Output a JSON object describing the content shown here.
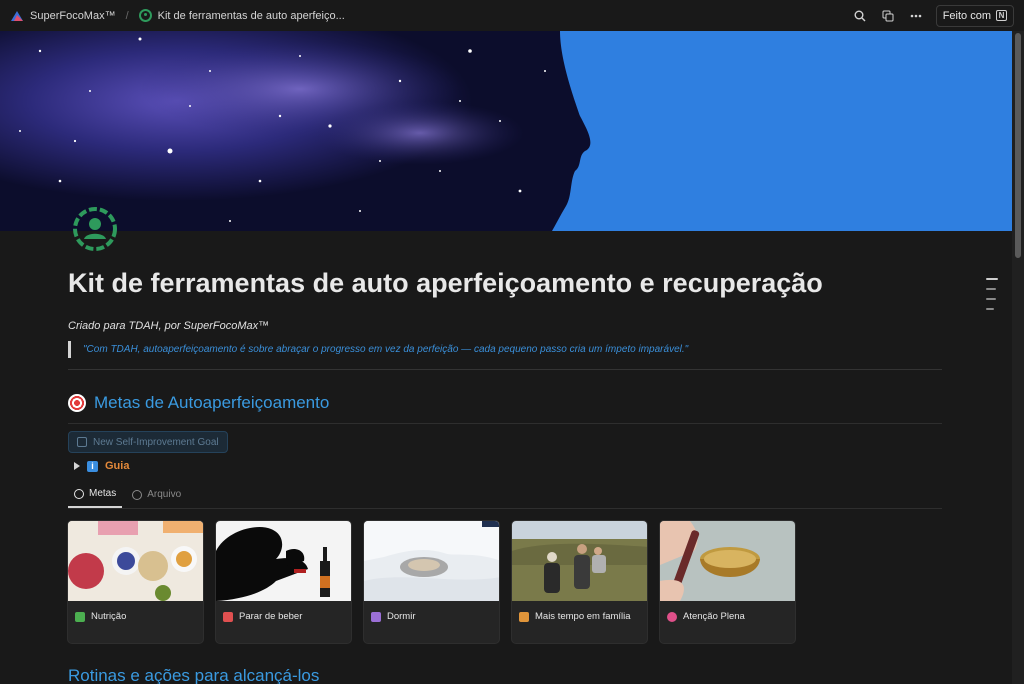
{
  "breadcrumb": {
    "workspace": "SuperFocoMax™",
    "page": "Kit de ferramentas de auto aperfeiço..."
  },
  "topbar": {
    "made_with": "Feito com"
  },
  "page": {
    "title": "Kit de ferramentas de auto aperfeiçoamento e recuperação",
    "subtitle": "Criado para TDAH, por SuperFocoMax™",
    "quote": "\"Com TDAH, autoaperfeiçoamento é sobre abraçar o progresso em vez da perfeição — cada pequeno passo cria um ímpeto imparável.\""
  },
  "goals": {
    "heading": "Metas de Autoaperfeiçoamento",
    "new_button": "New Self-Improvement Goal",
    "guide": "Guia",
    "tabs": [
      {
        "label": "Metas"
      },
      {
        "label": "Arquivo"
      }
    ],
    "cards": [
      {
        "label": "Nutrição",
        "icon": "utensils-icon",
        "color": "#4caf50"
      },
      {
        "label": "Parar de beber",
        "icon": "wine-glass-icon",
        "color": "#e05050"
      },
      {
        "label": "Dormir",
        "icon": "bed-icon",
        "color": "#9b6fd6"
      },
      {
        "label": "Mais tempo em família",
        "icon": "family-icon",
        "color": "#e0953a"
      },
      {
        "label": "Atenção Plena",
        "icon": "mindfulness-icon",
        "color": "#e0508a"
      }
    ]
  },
  "routines": {
    "heading": "Rotinas e ações para alcançá-los"
  },
  "colors": {
    "accent": "#3a9ae0",
    "page_icon": "#2e9a5c",
    "guide": "#e3893a"
  }
}
